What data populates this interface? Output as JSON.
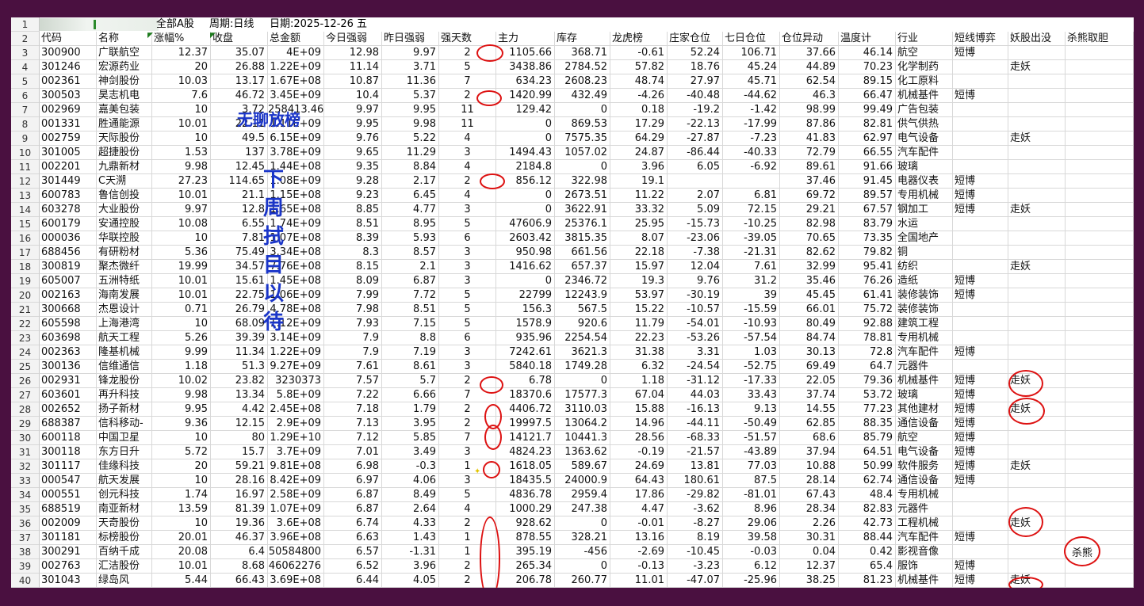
{
  "toolbar": {
    "scope": "全部A股",
    "period": "周期:日线",
    "date": "日期:2025-12-26 五"
  },
  "columns": [
    "代码",
    "名称",
    "涨幅%",
    "收盘",
    "总金额",
    "今日强弱",
    "昨日强弱",
    "强天数",
    "主力",
    "库存",
    "龙虎榜",
    "庄家仓位",
    "七日仓位",
    "仓位异动",
    "温度计",
    "行业",
    "短线博弈",
    "妖股出没",
    "杀熊取胆"
  ],
  "header_row_num": "2",
  "title_row_num": "1",
  "rows": [
    {
      "n": "3",
      "c": [
        "300900",
        "广联航空",
        "12.37",
        "35.07",
        "4E+09",
        "12.98",
        "9.97",
        "2",
        "1105.66",
        "368.71",
        "-0.61",
        "52.24",
        "106.71",
        "37.66",
        "46.14",
        "航空",
        "短博",
        ""
      ]
    },
    {
      "n": "4",
      "c": [
        "301246",
        "宏源药业",
        "20",
        "26.88",
        "1.22E+09",
        "11.14",
        "3.71",
        "5",
        "3438.86",
        "2784.52",
        "57.82",
        "18.76",
        "45.24",
        "44.89",
        "70.23",
        "化学制药",
        "",
        "走妖"
      ]
    },
    {
      "n": "5",
      "c": [
        "002361",
        "神剑股份",
        "10.03",
        "13.17",
        "1.67E+08",
        "10.87",
        "11.36",
        "7",
        "634.23",
        "2608.23",
        "48.74",
        "27.97",
        "45.71",
        "62.54",
        "89.15",
        "化工原料",
        "",
        ""
      ]
    },
    {
      "n": "6",
      "c": [
        "300503",
        "昊志机电",
        "7.6",
        "46.72",
        "3.45E+09",
        "10.4",
        "5.37",
        "2",
        "1420.99",
        "432.49",
        "-4.26",
        "-40.48",
        "-44.62",
        "46.3",
        "66.47",
        "机械基件",
        "短博",
        ""
      ]
    },
    {
      "n": "7",
      "c": [
        "002969",
        "嘉美包装",
        "10",
        "3.72",
        "258413.46",
        "9.97",
        "9.95",
        "11",
        "129.42",
        "0",
        "0.18",
        "-19.2",
        "-1.42",
        "98.99",
        "99.49",
        "广告包装",
        "",
        ""
      ]
    },
    {
      "n": "8",
      "c": [
        "001331",
        "胜通能源",
        "10.01",
        "22.11",
        "1.11E+09",
        "9.95",
        "9.98",
        "11",
        "0",
        "869.53",
        "17.29",
        "-22.13",
        "-17.99",
        "87.86",
        "82.81",
        "供气供热",
        "",
        ""
      ]
    },
    {
      "n": "9",
      "c": [
        "002759",
        "天际股份",
        "10",
        "49.5",
        "6.15E+09",
        "9.76",
        "5.22",
        "4",
        "0",
        "7575.35",
        "64.29",
        "-27.87",
        "-7.23",
        "41.83",
        "62.97",
        "电气设备",
        "",
        "走妖"
      ]
    },
    {
      "n": "10",
      "c": [
        "301005",
        "超捷股份",
        "1.53",
        "137",
        "3.78E+09",
        "9.65",
        "11.29",
        "3",
        "1494.43",
        "1057.02",
        "24.87",
        "-86.44",
        "-40.33",
        "72.79",
        "66.55",
        "汽车配件",
        "",
        ""
      ]
    },
    {
      "n": "11",
      "c": [
        "002201",
        "九鼎新材",
        "9.98",
        "12.45",
        "1.44E+08",
        "9.35",
        "8.84",
        "4",
        "2184.8",
        "0",
        "3.96",
        "6.05",
        "-6.92",
        "89.61",
        "91.66",
        "玻璃",
        "",
        ""
      ]
    },
    {
      "n": "12",
      "c": [
        "301449",
        "C天溯",
        "27.23",
        "114.65",
        "1.08E+09",
        "9.28",
        "2.17",
        "2",
        "856.12",
        "322.98",
        "19.1",
        "",
        "",
        "37.46",
        "91.45",
        "电器仪表",
        "短博",
        ""
      ]
    },
    {
      "n": "13",
      "c": [
        "600783",
        "鲁信创投",
        "10.01",
        "21.1",
        "1.15E+08",
        "9.23",
        "6.45",
        "4",
        "0",
        "2673.51",
        "11.22",
        "2.07",
        "6.81",
        "69.72",
        "89.57",
        "专用机械",
        "短博",
        ""
      ]
    },
    {
      "n": "14",
      "c": [
        "603278",
        "大业股份",
        "9.97",
        "12.8",
        "1.65E+08",
        "8.85",
        "4.77",
        "3",
        "0",
        "3622.91",
        "33.32",
        "5.09",
        "72.15",
        "29.21",
        "67.57",
        "钢加工",
        "短博",
        "走妖"
      ]
    },
    {
      "n": "15",
      "c": [
        "600179",
        "安通控股",
        "10.08",
        "6.55",
        "1.74E+09",
        "8.51",
        "8.95",
        "5",
        "47606.9",
        "25376.1",
        "25.95",
        "-15.73",
        "-10.25",
        "82.98",
        "83.79",
        "水运",
        "",
        ""
      ]
    },
    {
      "n": "16",
      "c": [
        "000036",
        "华联控股",
        "10",
        "7.81",
        "1.07E+08",
        "8.39",
        "5.93",
        "6",
        "2603.42",
        "3815.35",
        "8.07",
        "-23.06",
        "-39.05",
        "70.65",
        "73.35",
        "全国地产",
        "",
        ""
      ]
    },
    {
      "n": "17",
      "c": [
        "688456",
        "有研粉材",
        "5.36",
        "75.49",
        "3.34E+08",
        "8.3",
        "8.57",
        "3",
        "950.98",
        "661.56",
        "22.18",
        "-7.38",
        "-21.31",
        "82.62",
        "79.82",
        "铜",
        "",
        ""
      ]
    },
    {
      "n": "18",
      "c": [
        "300819",
        "聚杰微纤",
        "19.99",
        "34.57",
        "7.76E+08",
        "8.15",
        "2.1",
        "3",
        "1416.62",
        "657.37",
        "15.97",
        "12.04",
        "7.61",
        "32.99",
        "95.41",
        "纺织",
        "",
        "走妖"
      ]
    },
    {
      "n": "19",
      "c": [
        "605007",
        "五洲特纸",
        "10.01",
        "15.61",
        "1.45E+08",
        "8.09",
        "6.87",
        "3",
        "0",
        "2346.72",
        "19.3",
        "9.76",
        "31.2",
        "35.46",
        "76.26",
        "造纸",
        "短博",
        ""
      ]
    },
    {
      "n": "20",
      "c": [
        "002163",
        "海南发展",
        "10.01",
        "22.75",
        "1.06E+09",
        "7.99",
        "7.72",
        "5",
        "22799",
        "12243.9",
        "53.97",
        "-30.19",
        "39",
        "45.45",
        "61.41",
        "装修装饰",
        "短博",
        ""
      ]
    },
    {
      "n": "21",
      "c": [
        "300668",
        "杰恩设计",
        "0.71",
        "26.79",
        "4.78E+08",
        "7.98",
        "8.51",
        "5",
        "156.3",
        "567.5",
        "15.22",
        "-10.57",
        "-15.59",
        "66.01",
        "75.72",
        "装修装饰",
        "",
        ""
      ]
    },
    {
      "n": "22",
      "c": [
        "605598",
        "上海港湾",
        "10",
        "68.09",
        "1.12E+09",
        "7.93",
        "7.15",
        "5",
        "1578.9",
        "920.6",
        "11.79",
        "-54.01",
        "-10.93",
        "80.49",
        "92.88",
        "建筑工程",
        "",
        ""
      ]
    },
    {
      "n": "23",
      "c": [
        "603698",
        "航天工程",
        "5.26",
        "39.39",
        "3.14E+09",
        "7.9",
        "8.8",
        "6",
        "935.96",
        "2254.54",
        "22.23",
        "-53.26",
        "-57.54",
        "84.74",
        "78.81",
        "专用机械",
        "",
        ""
      ]
    },
    {
      "n": "24",
      "c": [
        "002363",
        "隆基机械",
        "9.99",
        "11.34",
        "1.22E+09",
        "7.9",
        "7.19",
        "3",
        "7242.61",
        "3621.3",
        "31.38",
        "3.31",
        "1.03",
        "30.13",
        "72.8",
        "汽车配件",
        "短博",
        ""
      ]
    },
    {
      "n": "25",
      "c": [
        "300136",
        "信维通信",
        "1.18",
        "51.3",
        "9.27E+09",
        "7.61",
        "8.61",
        "3",
        "5840.18",
        "1749.28",
        "6.32",
        "-24.54",
        "-52.75",
        "69.49",
        "64.7",
        "元器件",
        "",
        ""
      ]
    },
    {
      "n": "26",
      "c": [
        "002931",
        "锋龙股份",
        "10.02",
        "23.82",
        "3230373",
        "7.57",
        "5.7",
        "2",
        "6.78",
        "0",
        "1.18",
        "-31.12",
        "-17.33",
        "22.05",
        "79.36",
        "机械基件",
        "短博",
        "走妖"
      ]
    },
    {
      "n": "27",
      "c": [
        "603601",
        "再升科技",
        "9.98",
        "13.34",
        "5.8E+09",
        "7.22",
        "6.66",
        "7",
        "18370.6",
        "17577.3",
        "67.04",
        "44.03",
        "33.43",
        "37.74",
        "53.72",
        "玻璃",
        "短博",
        ""
      ]
    },
    {
      "n": "28",
      "c": [
        "002652",
        "扬子新材",
        "9.95",
        "4.42",
        "2.45E+08",
        "7.18",
        "1.79",
        "2",
        "4406.72",
        "3110.03",
        "15.88",
        "-16.13",
        "9.13",
        "14.55",
        "77.23",
        "其他建材",
        "短博",
        "走妖"
      ]
    },
    {
      "n": "29",
      "c": [
        "688387",
        "信科移动-",
        "9.36",
        "12.15",
        "2.9E+09",
        "7.13",
        "3.95",
        "2",
        "19997.5",
        "13064.2",
        "14.96",
        "-44.11",
        "-50.49",
        "62.85",
        "88.35",
        "通信设备",
        "短博",
        ""
      ]
    },
    {
      "n": "30",
      "c": [
        "600118",
        "中国卫星",
        "10",
        "80",
        "1.29E+10",
        "7.12",
        "5.85",
        "7",
        "14121.7",
        "10441.3",
        "28.56",
        "-68.33",
        "-51.57",
        "68.6",
        "85.79",
        "航空",
        "短博",
        ""
      ]
    },
    {
      "n": "31",
      "c": [
        "300118",
        "东方日升",
        "5.72",
        "15.7",
        "3.7E+09",
        "7.01",
        "3.49",
        "3",
        "4824.23",
        "1363.62",
        "-0.19",
        "-21.57",
        "-43.89",
        "37.94",
        "64.51",
        "电气设备",
        "短博",
        ""
      ]
    },
    {
      "n": "32",
      "c": [
        "301117",
        "佳缘科技",
        "20",
        "59.21",
        "9.81E+08",
        "6.98",
        "-0.3",
        "1",
        "1618.05",
        "589.67",
        "24.69",
        "13.81",
        "77.03",
        "10.88",
        "50.99",
        "软件服务",
        "短博",
        "走妖"
      ]
    },
    {
      "n": "33",
      "c": [
        "000547",
        "航天发展",
        "10",
        "28.16",
        "8.42E+09",
        "6.97",
        "4.06",
        "3",
        "18435.5",
        "24000.9",
        "64.43",
        "180.61",
        "87.5",
        "28.14",
        "62.74",
        "通信设备",
        "短博",
        ""
      ]
    },
    {
      "n": "34",
      "c": [
        "000551",
        "创元科技",
        "1.74",
        "16.97",
        "2.58E+09",
        "6.87",
        "8.49",
        "5",
        "4836.78",
        "2959.4",
        "17.86",
        "-29.82",
        "-81.01",
        "67.43",
        "48.4",
        "专用机械",
        "",
        ""
      ]
    },
    {
      "n": "35",
      "c": [
        "688519",
        "南亚新材",
        "13.59",
        "81.39",
        "1.07E+09",
        "6.87",
        "2.64",
        "4",
        "1000.29",
        "247.38",
        "4.47",
        "-3.62",
        "8.96",
        "28.34",
        "82.83",
        "元器件",
        "",
        ""
      ]
    },
    {
      "n": "36",
      "c": [
        "002009",
        "天奇股份",
        "10",
        "19.36",
        "3.6E+08",
        "6.74",
        "4.33",
        "2",
        "928.62",
        "0",
        "-0.01",
        "-8.27",
        "29.06",
        "2.26",
        "42.73",
        "工程机械",
        "",
        "走妖"
      ]
    },
    {
      "n": "37",
      "c": [
        "301181",
        "标榜股份",
        "20.01",
        "46.37",
        "3.96E+08",
        "6.63",
        "1.43",
        "1",
        "878.55",
        "328.21",
        "13.16",
        "8.19",
        "39.58",
        "30.31",
        "88.44",
        "汽车配件",
        "短博",
        ""
      ]
    },
    {
      "n": "38",
      "c": [
        "300291",
        "百纳千成",
        "20.08",
        "6.4",
        "50584800",
        "6.57",
        "-1.31",
        "1",
        "395.19",
        "-456",
        "-2.69",
        "-10.45",
        "-0.03",
        "0.04",
        "0.42",
        "影视音像",
        "",
        ""
      ]
    },
    {
      "n": "39",
      "c": [
        "002763",
        "汇洁股份",
        "10.01",
        "8.68",
        "46062276",
        "6.52",
        "3.96",
        "2",
        "265.34",
        "0",
        "-0.13",
        "-3.23",
        "6.12",
        "12.37",
        "65.4",
        "服饰",
        "短博",
        ""
      ]
    },
    {
      "n": "40",
      "c": [
        "301043",
        "绿岛风",
        "5.44",
        "66.43",
        "3.69E+08",
        "6.44",
        "4.05",
        "2",
        "206.78",
        "260.77",
        "11.01",
        "-47.07",
        "-25.96",
        "38.25",
        "81.23",
        "机械基件",
        "短博",
        "走妖"
      ]
    }
  ],
  "annotations": {
    "note_top": "无聊放榜",
    "note_vertical": [
      "下",
      "周",
      "拭",
      "目",
      "以",
      "待"
    ],
    "kill_bear": "杀熊"
  },
  "colors": {
    "background": "#4a1040",
    "annotation_blue": "#1a35c8",
    "circle_red": "#dd1111"
  }
}
